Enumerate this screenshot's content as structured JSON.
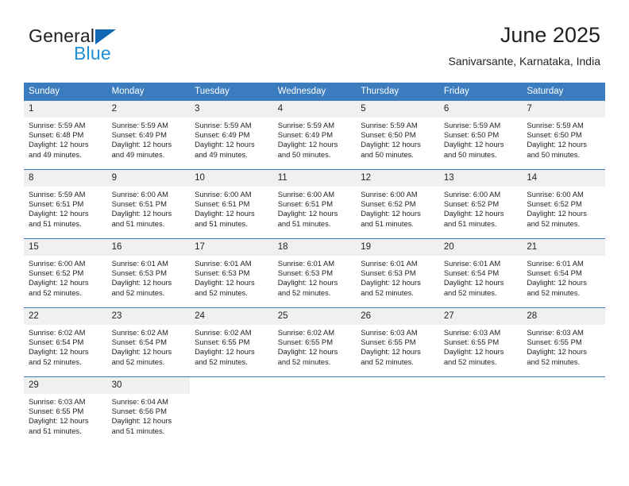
{
  "logo": {
    "word_top": "General",
    "word_bottom": "Blue",
    "triangle_color": "#1268b3",
    "blue_color": "#1d8fd4"
  },
  "header": {
    "title": "June 2025",
    "subtitle": "Sanivarsante, Karnataka, India"
  },
  "theme": {
    "header_bg": "#3a7cbe",
    "daynum_bg": "#f0f0f0",
    "text": "#231f20"
  },
  "weekday_headers": [
    "Sunday",
    "Monday",
    "Tuesday",
    "Wednesday",
    "Thursday",
    "Friday",
    "Saturday"
  ],
  "labels": {
    "sunrise_prefix": "Sunrise:",
    "sunset_prefix": "Sunset:",
    "daylight_prefix": "Daylight:"
  },
  "weeks": [
    [
      {
        "day": "1",
        "sunrise": "Sunrise: 5:59 AM",
        "sunset": "Sunset: 6:48 PM",
        "daylight": "Daylight: 12 hours and 49 minutes."
      },
      {
        "day": "2",
        "sunrise": "Sunrise: 5:59 AM",
        "sunset": "Sunset: 6:49 PM",
        "daylight": "Daylight: 12 hours and 49 minutes."
      },
      {
        "day": "3",
        "sunrise": "Sunrise: 5:59 AM",
        "sunset": "Sunset: 6:49 PM",
        "daylight": "Daylight: 12 hours and 49 minutes."
      },
      {
        "day": "4",
        "sunrise": "Sunrise: 5:59 AM",
        "sunset": "Sunset: 6:49 PM",
        "daylight": "Daylight: 12 hours and 50 minutes."
      },
      {
        "day": "5",
        "sunrise": "Sunrise: 5:59 AM",
        "sunset": "Sunset: 6:50 PM",
        "daylight": "Daylight: 12 hours and 50 minutes."
      },
      {
        "day": "6",
        "sunrise": "Sunrise: 5:59 AM",
        "sunset": "Sunset: 6:50 PM",
        "daylight": "Daylight: 12 hours and 50 minutes."
      },
      {
        "day": "7",
        "sunrise": "Sunrise: 5:59 AM",
        "sunset": "Sunset: 6:50 PM",
        "daylight": "Daylight: 12 hours and 50 minutes."
      }
    ],
    [
      {
        "day": "8",
        "sunrise": "Sunrise: 5:59 AM",
        "sunset": "Sunset: 6:51 PM",
        "daylight": "Daylight: 12 hours and 51 minutes."
      },
      {
        "day": "9",
        "sunrise": "Sunrise: 6:00 AM",
        "sunset": "Sunset: 6:51 PM",
        "daylight": "Daylight: 12 hours and 51 minutes."
      },
      {
        "day": "10",
        "sunrise": "Sunrise: 6:00 AM",
        "sunset": "Sunset: 6:51 PM",
        "daylight": "Daylight: 12 hours and 51 minutes."
      },
      {
        "day": "11",
        "sunrise": "Sunrise: 6:00 AM",
        "sunset": "Sunset: 6:51 PM",
        "daylight": "Daylight: 12 hours and 51 minutes."
      },
      {
        "day": "12",
        "sunrise": "Sunrise: 6:00 AM",
        "sunset": "Sunset: 6:52 PM",
        "daylight": "Daylight: 12 hours and 51 minutes."
      },
      {
        "day": "13",
        "sunrise": "Sunrise: 6:00 AM",
        "sunset": "Sunset: 6:52 PM",
        "daylight": "Daylight: 12 hours and 51 minutes."
      },
      {
        "day": "14",
        "sunrise": "Sunrise: 6:00 AM",
        "sunset": "Sunset: 6:52 PM",
        "daylight": "Daylight: 12 hours and 52 minutes."
      }
    ],
    [
      {
        "day": "15",
        "sunrise": "Sunrise: 6:00 AM",
        "sunset": "Sunset: 6:52 PM",
        "daylight": "Daylight: 12 hours and 52 minutes."
      },
      {
        "day": "16",
        "sunrise": "Sunrise: 6:01 AM",
        "sunset": "Sunset: 6:53 PM",
        "daylight": "Daylight: 12 hours and 52 minutes."
      },
      {
        "day": "17",
        "sunrise": "Sunrise: 6:01 AM",
        "sunset": "Sunset: 6:53 PM",
        "daylight": "Daylight: 12 hours and 52 minutes."
      },
      {
        "day": "18",
        "sunrise": "Sunrise: 6:01 AM",
        "sunset": "Sunset: 6:53 PM",
        "daylight": "Daylight: 12 hours and 52 minutes."
      },
      {
        "day": "19",
        "sunrise": "Sunrise: 6:01 AM",
        "sunset": "Sunset: 6:53 PM",
        "daylight": "Daylight: 12 hours and 52 minutes."
      },
      {
        "day": "20",
        "sunrise": "Sunrise: 6:01 AM",
        "sunset": "Sunset: 6:54 PM",
        "daylight": "Daylight: 12 hours and 52 minutes."
      },
      {
        "day": "21",
        "sunrise": "Sunrise: 6:01 AM",
        "sunset": "Sunset: 6:54 PM",
        "daylight": "Daylight: 12 hours and 52 minutes."
      }
    ],
    [
      {
        "day": "22",
        "sunrise": "Sunrise: 6:02 AM",
        "sunset": "Sunset: 6:54 PM",
        "daylight": "Daylight: 12 hours and 52 minutes."
      },
      {
        "day": "23",
        "sunrise": "Sunrise: 6:02 AM",
        "sunset": "Sunset: 6:54 PM",
        "daylight": "Daylight: 12 hours and 52 minutes."
      },
      {
        "day": "24",
        "sunrise": "Sunrise: 6:02 AM",
        "sunset": "Sunset: 6:55 PM",
        "daylight": "Daylight: 12 hours and 52 minutes."
      },
      {
        "day": "25",
        "sunrise": "Sunrise: 6:02 AM",
        "sunset": "Sunset: 6:55 PM",
        "daylight": "Daylight: 12 hours and 52 minutes."
      },
      {
        "day": "26",
        "sunrise": "Sunrise: 6:03 AM",
        "sunset": "Sunset: 6:55 PM",
        "daylight": "Daylight: 12 hours and 52 minutes."
      },
      {
        "day": "27",
        "sunrise": "Sunrise: 6:03 AM",
        "sunset": "Sunset: 6:55 PM",
        "daylight": "Daylight: 12 hours and 52 minutes."
      },
      {
        "day": "28",
        "sunrise": "Sunrise: 6:03 AM",
        "sunset": "Sunset: 6:55 PM",
        "daylight": "Daylight: 12 hours and 52 minutes."
      }
    ],
    [
      {
        "day": "29",
        "sunrise": "Sunrise: 6:03 AM",
        "sunset": "Sunset: 6:55 PM",
        "daylight": "Daylight: 12 hours and 51 minutes."
      },
      {
        "day": "30",
        "sunrise": "Sunrise: 6:04 AM",
        "sunset": "Sunset: 6:56 PM",
        "daylight": "Daylight: 12 hours and 51 minutes."
      },
      {
        "day": "",
        "sunrise": "",
        "sunset": "",
        "daylight": ""
      },
      {
        "day": "",
        "sunrise": "",
        "sunset": "",
        "daylight": ""
      },
      {
        "day": "",
        "sunrise": "",
        "sunset": "",
        "daylight": ""
      },
      {
        "day": "",
        "sunrise": "",
        "sunset": "",
        "daylight": ""
      },
      {
        "day": "",
        "sunrise": "",
        "sunset": "",
        "daylight": ""
      }
    ]
  ]
}
